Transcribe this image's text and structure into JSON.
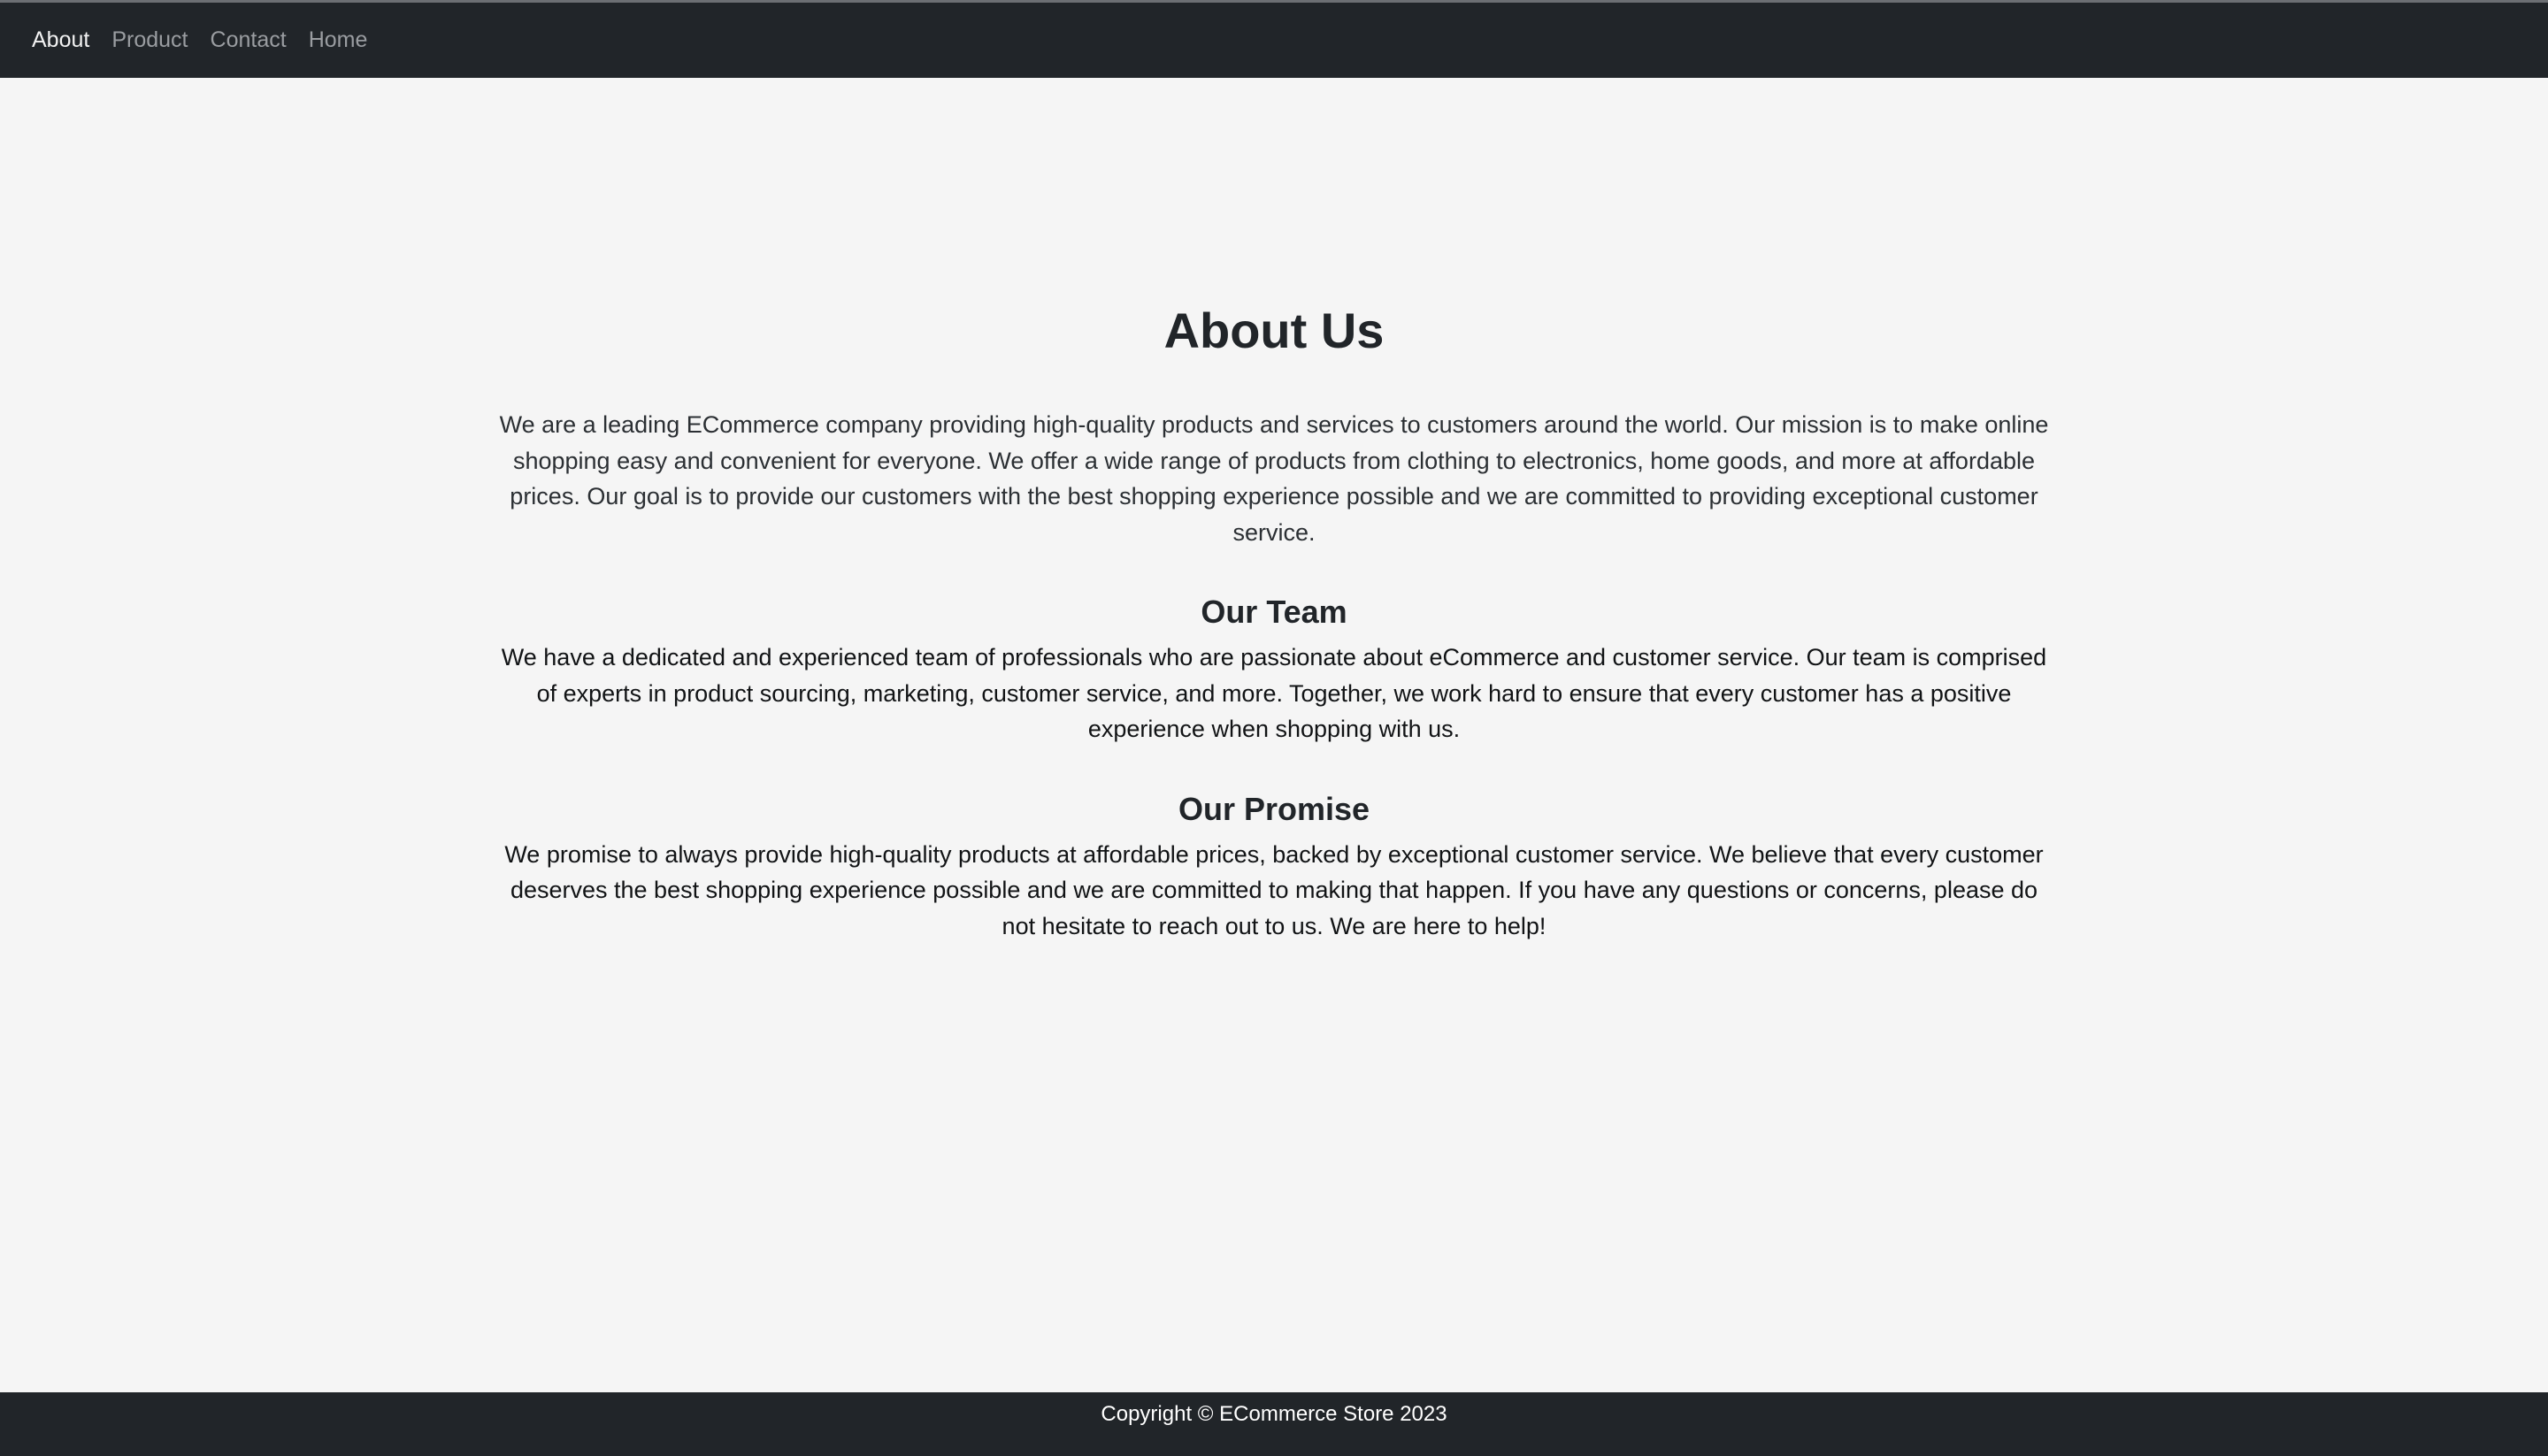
{
  "nav": {
    "items": [
      {
        "label": "About",
        "active": true
      },
      {
        "label": "Product",
        "active": false
      },
      {
        "label": "Contact",
        "active": false
      },
      {
        "label": "Home",
        "active": false
      }
    ]
  },
  "main": {
    "title": "About Us",
    "intro": "We are a leading ECommerce company providing high-quality products and services to customers around the world. Our mission is to make online shopping easy and convenient for everyone. We offer a wide range of products from clothing to electronics, home goods, and more at affordable prices. Our goal is to provide our customers with the best shopping experience possible and we are committed to providing exceptional customer service.",
    "sections": [
      {
        "title": "Our Team",
        "text": "We have a dedicated and experienced team of professionals who are passionate about eCommerce and customer service. Our team is comprised of experts in product sourcing, marketing, customer service, and more. Together, we work hard to ensure that every customer has a positive experience when shopping with us."
      },
      {
        "title": "Our Promise",
        "text": "We promise to always provide high-quality products at affordable prices, backed by exceptional customer service. We believe that every customer deserves the best shopping experience possible and we are committed to making that happen. If you have any questions or concerns, please do not hesitate to reach out to us. We are here to help!"
      }
    ]
  },
  "footer": {
    "copyright": "Copyright © ECommerce Store 2023"
  },
  "colors": {
    "navbar_bg": "#212529",
    "page_bg": "#f5f5f5",
    "nav_active": "#f2f2f2",
    "nav_inactive": "#9a9da1",
    "footer_text": "#ffffff"
  }
}
